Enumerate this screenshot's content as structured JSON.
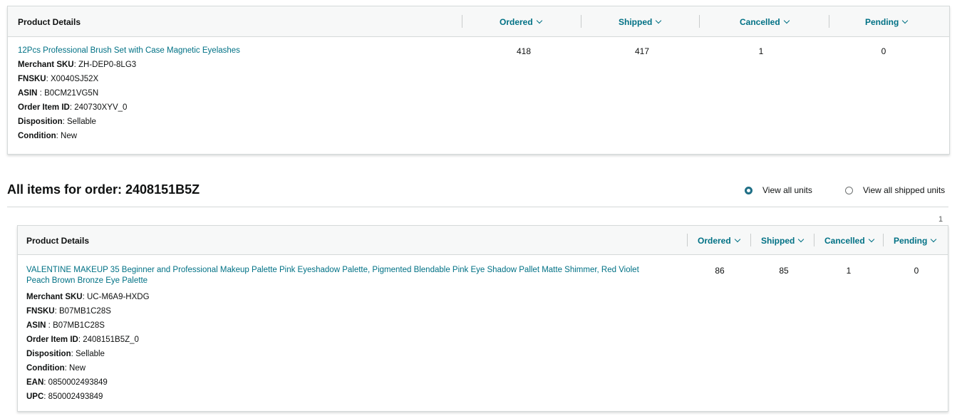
{
  "summary_table": {
    "headers": {
      "product_details": "Product Details",
      "ordered": "Ordered",
      "shipped": "Shipped",
      "cancelled": "Cancelled",
      "pending": "Pending"
    },
    "row": {
      "title": "12Pcs Professional Brush Set with Case Magnetic Eyelashes",
      "attributes": [
        {
          "label": "Merchant SKU",
          "sep": ": ",
          "value": "ZH-DEP0-8LG3"
        },
        {
          "label": "FNSKU",
          "sep": ": ",
          "value": "X0040SJ52X"
        },
        {
          "label": "ASIN",
          "sep": " : ",
          "value": "B0CM21VG5N"
        },
        {
          "label": "Order Item ID",
          "sep": ": ",
          "value": "240730XYV_0"
        },
        {
          "label": "Disposition",
          "sep": ": ",
          "value": "Sellable"
        },
        {
          "label": "Condition",
          "sep": ": ",
          "value": "New"
        }
      ],
      "ordered": "418",
      "shipped": "417",
      "cancelled": "1",
      "pending": "0"
    }
  },
  "order_section": {
    "title": "All items for order: 2408151B5Z",
    "view_options": {
      "all_units": "View all units",
      "all_shipped_units": "View all shipped units",
      "selected": "all_units"
    },
    "page_number": "1"
  },
  "items_table": {
    "headers": {
      "product_details": "Product Details",
      "ordered": "Ordered",
      "shipped": "Shipped",
      "cancelled": "Cancelled",
      "pending": "Pending"
    },
    "row": {
      "title_line1": "VALENTINE MAKEUP 35 Beginner and Professional Makeup Palette Pink Eyeshadow Palette, Pigmented Blendable Pink Eye Shadow Pallet Matte Shimmer, Red Violet",
      "title_line2": "Peach Brown Bronze Eye Palette",
      "attributes": [
        {
          "label": "Merchant SKU",
          "sep": ": ",
          "value": "UC-M6A9-HXDG"
        },
        {
          "label": "FNSKU",
          "sep": ": ",
          "value": "B07MB1C28S"
        },
        {
          "label": "ASIN",
          "sep": " : ",
          "value": "B07MB1C28S"
        },
        {
          "label": "Order Item ID",
          "sep": ": ",
          "value": "2408151B5Z_0"
        },
        {
          "label": "Disposition",
          "sep": ": ",
          "value": "Sellable"
        },
        {
          "label": "Condition",
          "sep": ": ",
          "value": "New"
        },
        {
          "label": "EAN",
          "sep": ": ",
          "value": "0850002493849"
        },
        {
          "label": "UPC",
          "sep": ": ",
          "value": "850002493849"
        }
      ],
      "ordered": "86",
      "shipped": "85",
      "cancelled": "1",
      "pending": "0"
    }
  },
  "colors": {
    "link": "#007185",
    "radio_selected": "#1f6f86",
    "border": "#d5d9d9",
    "header_bg": "#f7f8f8"
  }
}
